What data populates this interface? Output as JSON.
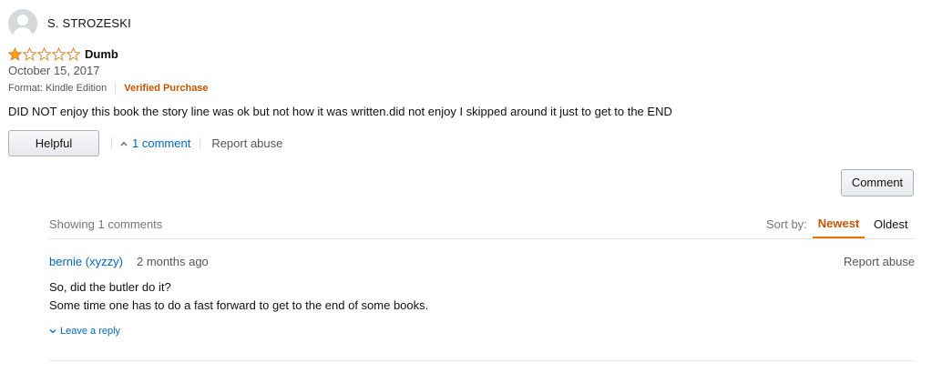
{
  "review": {
    "reviewer_name": "S. STROZESKI",
    "rating": 1,
    "rating_max": 5,
    "title": "Dumb",
    "date": "October 15, 2017",
    "format": "Format: Kindle Edition",
    "verified": "Verified Purchase",
    "body": "DID NOT enjoy this book the story line was ok but not how it was written.did not enjoy I skipped around it just to get to the END"
  },
  "actions": {
    "helpful_label": "Helpful",
    "comment_count_label": "1 comment",
    "report_label": "Report abuse",
    "comment_button_label": "Comment"
  },
  "comments": {
    "showing_label": "Showing 1 comments",
    "sort_label": "Sort by:",
    "sort_options": [
      "Newest",
      "Oldest"
    ],
    "active_sort": "Newest",
    "items": [
      {
        "author": "bernie (xyzzy)",
        "time": "2 months ago",
        "report_label": "Report abuse",
        "lines": [
          "So, did the butler do it?",
          "Some time one has to do a fast forward to get to the end of some books."
        ],
        "reply_label": "Leave a reply"
      }
    ]
  },
  "colors": {
    "link": "#0066c0",
    "verified": "#c45500",
    "star": "#ffa41c",
    "sort_active_underline": "#e77600"
  },
  "icons": [
    "avatar-icon",
    "star-icon",
    "caret-up-icon",
    "chevron-down-icon"
  ]
}
